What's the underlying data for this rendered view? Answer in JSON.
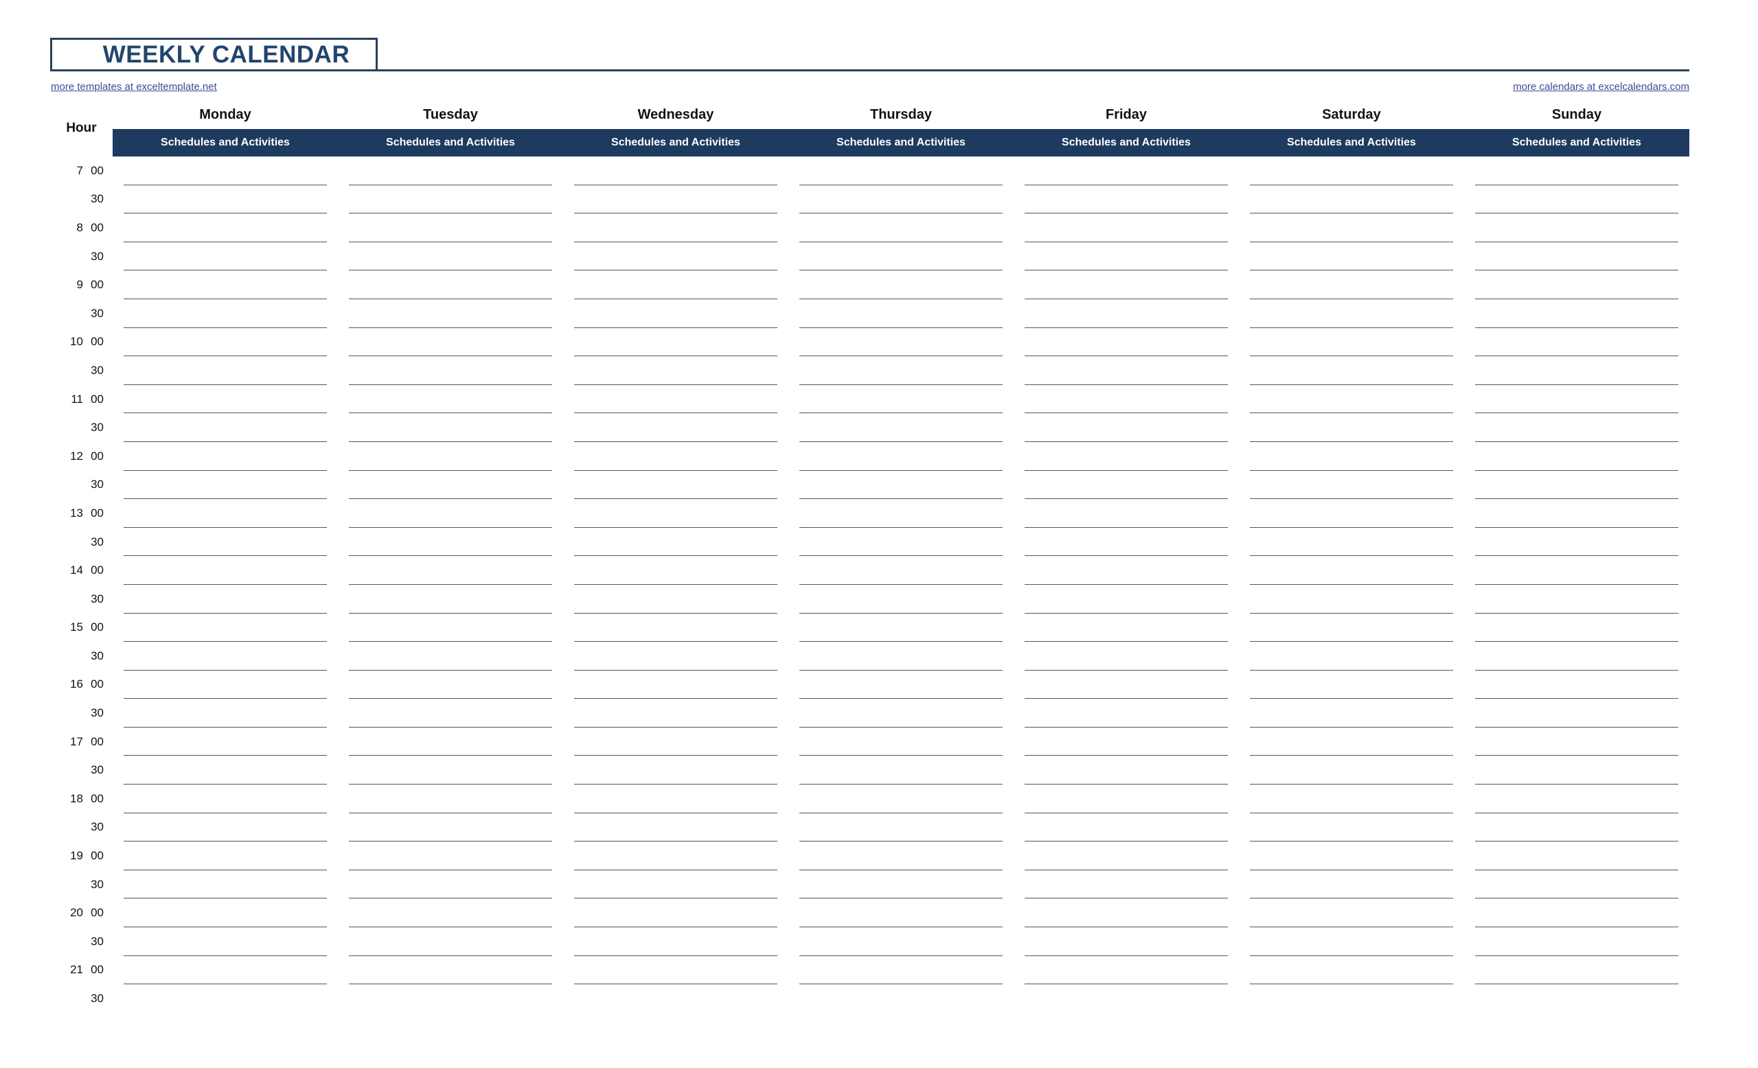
{
  "header": {
    "title": "WEEKLY CALENDAR",
    "link_left": "more templates at exceltemplate.net",
    "link_right": "more calendars at excelcalendars.com",
    "accent_color": "#1E3A5F",
    "title_color": "#22456B",
    "link_color": "#3B4B96"
  },
  "table": {
    "hour_column_label": "Hour",
    "sub_header_label": "Schedules and Activities",
    "days": [
      "Monday",
      "Tuesday",
      "Wednesday",
      "Thursday",
      "Friday",
      "Saturday",
      "Sunday"
    ],
    "rows": [
      {
        "hour": "7",
        "minute": "00"
      },
      {
        "hour": "",
        "minute": "30"
      },
      {
        "hour": "8",
        "minute": "00"
      },
      {
        "hour": "",
        "minute": "30"
      },
      {
        "hour": "9",
        "minute": "00"
      },
      {
        "hour": "",
        "minute": "30"
      },
      {
        "hour": "10",
        "minute": "00"
      },
      {
        "hour": "",
        "minute": "30"
      },
      {
        "hour": "11",
        "minute": "00"
      },
      {
        "hour": "",
        "minute": "30"
      },
      {
        "hour": "12",
        "minute": "00"
      },
      {
        "hour": "",
        "minute": "30"
      },
      {
        "hour": "13",
        "minute": "00"
      },
      {
        "hour": "",
        "minute": "30"
      },
      {
        "hour": "14",
        "minute": "00"
      },
      {
        "hour": "",
        "minute": "30"
      },
      {
        "hour": "15",
        "minute": "00"
      },
      {
        "hour": "",
        "minute": "30"
      },
      {
        "hour": "16",
        "minute": "00"
      },
      {
        "hour": "",
        "minute": "30"
      },
      {
        "hour": "17",
        "minute": "00"
      },
      {
        "hour": "",
        "minute": "30"
      },
      {
        "hour": "18",
        "minute": "00"
      },
      {
        "hour": "",
        "minute": "30"
      },
      {
        "hour": "19",
        "minute": "00"
      },
      {
        "hour": "",
        "minute": "30"
      },
      {
        "hour": "20",
        "minute": "00"
      },
      {
        "hour": "",
        "minute": "30"
      },
      {
        "hour": "21",
        "minute": "00"
      },
      {
        "hour": "",
        "minute": "30"
      }
    ]
  }
}
